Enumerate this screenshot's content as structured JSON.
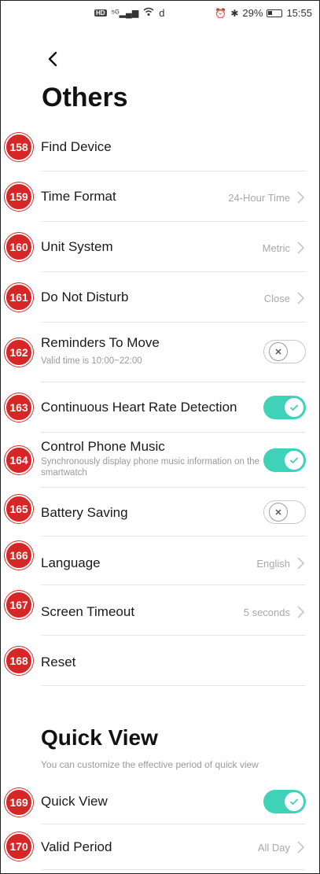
{
  "status_bar": {
    "left_text": "HD ⁵⁶.ıll",
    "hd": "HD",
    "signal": "⁵ᴳ.ıll",
    "wifi": "≋",
    "extra": "d",
    "battery_percent": "29%",
    "time": "15:55"
  },
  "header": {
    "title": "Others"
  },
  "rows": [
    {
      "badge": "158",
      "label": "Find Device"
    },
    {
      "badge": "159",
      "label": "Time Format",
      "value": "24-Hour Time"
    },
    {
      "badge": "160",
      "label": "Unit System",
      "value": "Metric"
    },
    {
      "badge": "161",
      "label": "Do Not Disturb",
      "value": "Close"
    },
    {
      "badge": "162",
      "label": "Reminders To Move",
      "sub": "Valid time is 10:00~22:00",
      "toggle": false
    },
    {
      "badge": "163",
      "label": "Continuous Heart Rate Detection",
      "toggle": true
    },
    {
      "badge": "164",
      "label": "Control Phone Music",
      "sub": "Synchronously display phone music information on the smartwatch",
      "toggle": true
    },
    {
      "badge": "165",
      "label": "Battery Saving",
      "toggle": false
    },
    {
      "badge": "166",
      "label": "Language",
      "value": "English"
    },
    {
      "badge": "167",
      "label": "Screen Timeout",
      "value": "5 seconds"
    },
    {
      "badge": "168",
      "label": "Reset"
    }
  ],
  "quick_view": {
    "title": "Quick View",
    "description": "You can customize the effective period of quick view",
    "rows": [
      {
        "badge": "169",
        "label": "Quick View",
        "toggle": true
      },
      {
        "badge": "170",
        "label": "Valid Period",
        "value": "All Day"
      }
    ]
  },
  "colors": {
    "accent": "#3ed2b8",
    "badge": "#d72626",
    "divider": "#e6e6e6",
    "secondary_text": "#a8a8a8"
  }
}
